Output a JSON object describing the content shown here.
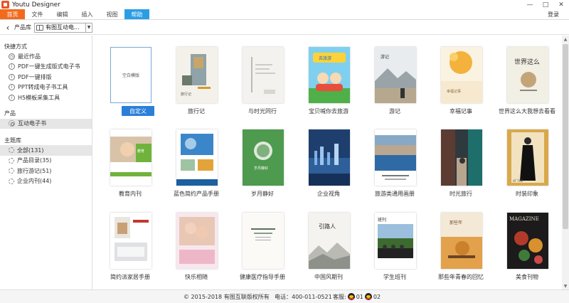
{
  "window": {
    "title": "Youtu Designer",
    "controls": [
      "—",
      "□",
      "✕"
    ]
  },
  "menubar": {
    "items": [
      "首页",
      "文件",
      "编辑",
      "插入",
      "视图",
      "帮助"
    ],
    "login": "登录"
  },
  "toolbar": {
    "library_label": "产品库",
    "library_value": "有图互动电..."
  },
  "sidebar": {
    "shortcuts_heading": "快捷方式",
    "shortcuts": [
      "最近作品",
      "PDF一键生成版式电子书",
      "PDF一键排版",
      "PPT转成电子书工具",
      "H5模板采集工具"
    ],
    "product_heading": "产品",
    "product_item": "互动电子书",
    "theme_heading": "主题库",
    "themes": [
      "全部(131)",
      "产品目录(35)",
      "旅行游记(51)",
      "企业内刊(44)"
    ]
  },
  "templates": {
    "blank_label": "空白模版",
    "custom_button": "自定义",
    "items": [
      "旅行记",
      "与时光同行",
      "宝贝喊你去旅游",
      "游记",
      "幸福记事",
      "世界这么大我想去看看",
      "教育内刊",
      "蓝色简约产品手册",
      "岁月静好",
      "企业视角",
      "旅游类通用画册",
      "时光旅行",
      "时装印象",
      "简约派家居手册",
      "快乐相随",
      "健康医疗指导手册",
      "中国风期刊",
      "学生班刊",
      "那些年青春的回忆",
      "美食刊物"
    ]
  },
  "thumbnails": {
    "travel_diary": "旅行记",
    "kids_travel": "去旅游",
    "youji": "游记",
    "happy": "幸福记事",
    "world": "世界这么",
    "edu": "教育",
    "jiangnan": "岁月静好",
    "mag_fashion": "AT THE",
    "journey": "引路人",
    "class": "班刊",
    "youth": "那些年",
    "magazine": "MAGAZINE"
  },
  "footer": {
    "copyright": "© 2015-2018 有图互联版权所有",
    "phone": "电话：400-011-0521",
    "service_label": "客服:",
    "service_1": "01",
    "service_2": "02"
  },
  "colors": {
    "home_tab": "#f26b1d",
    "active_tab": "#2a9ee4",
    "custom_button": "#2b7fd8"
  }
}
